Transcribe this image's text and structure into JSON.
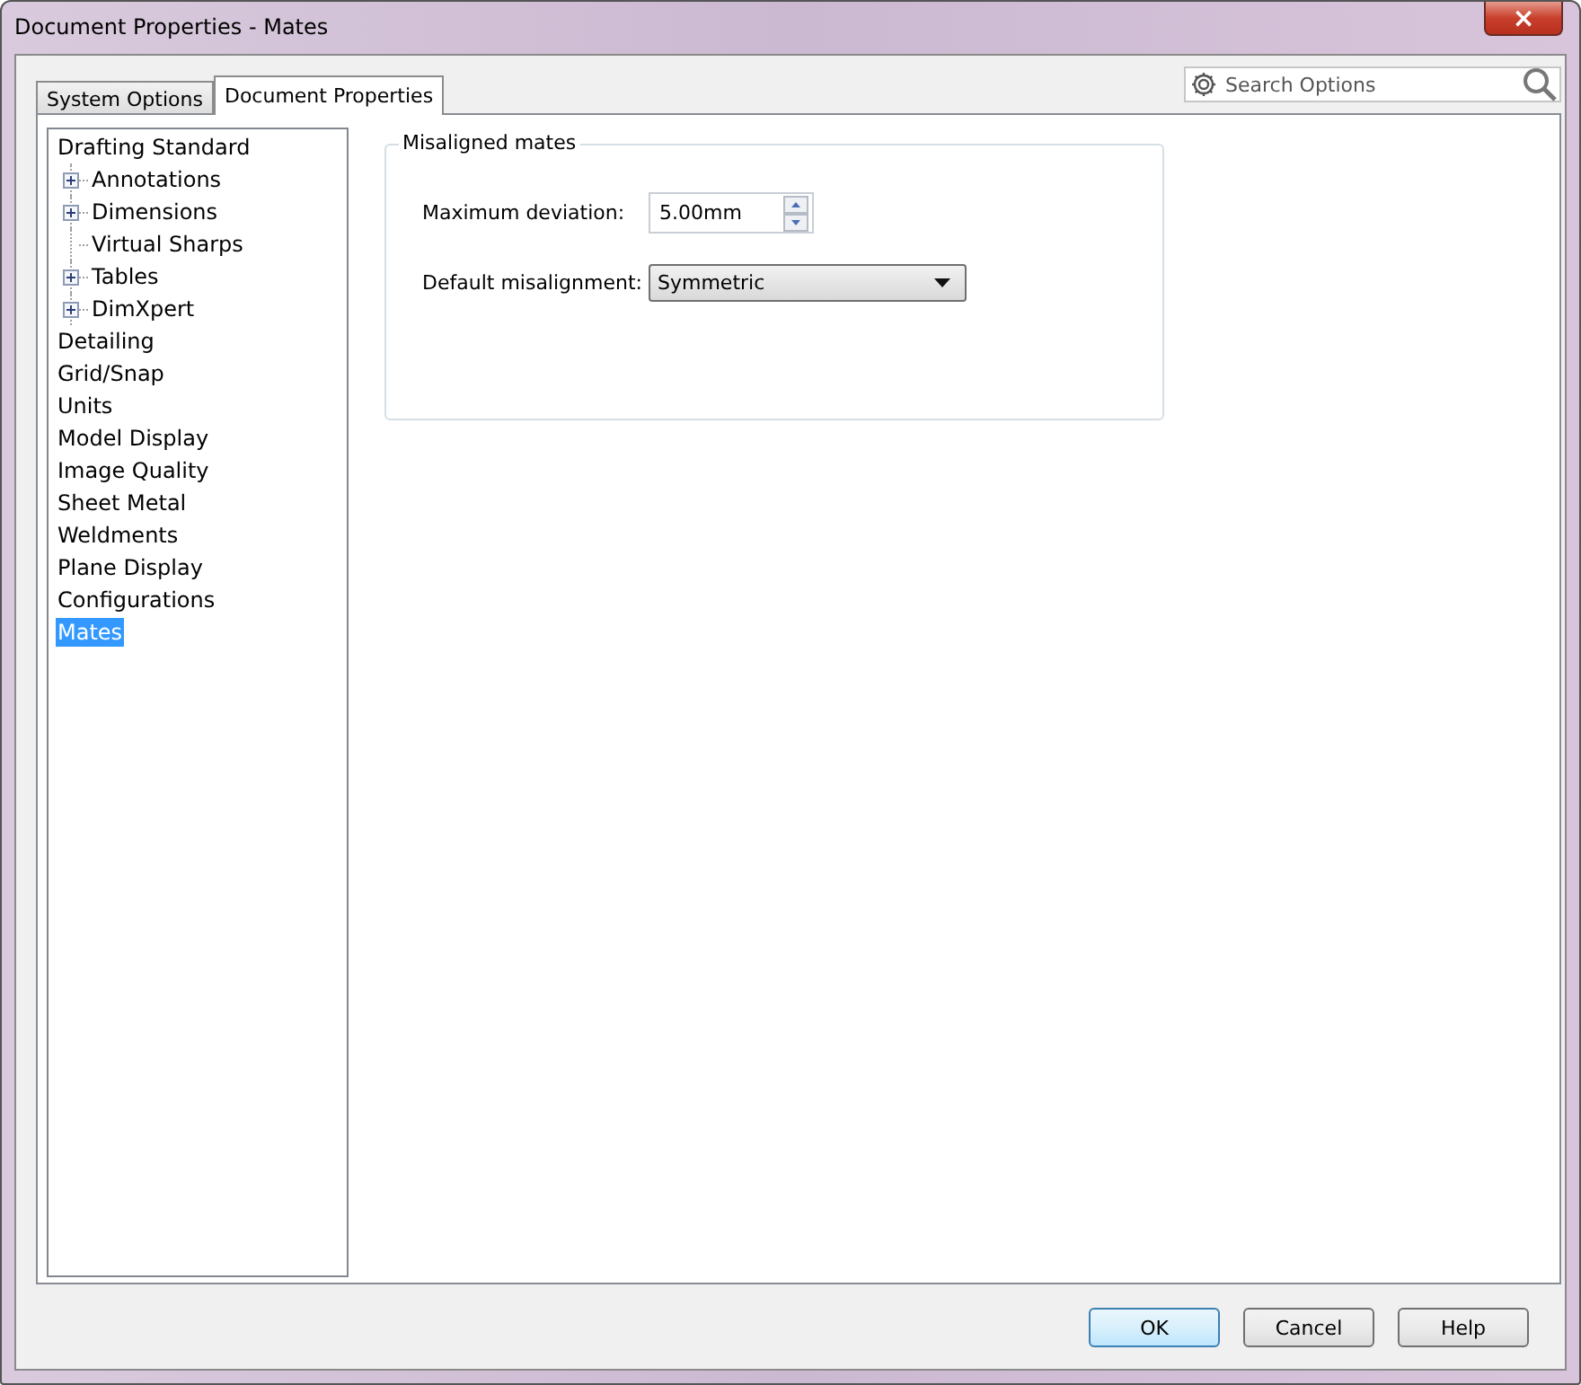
{
  "window": {
    "title": "Document Properties - Mates",
    "close": "×"
  },
  "tabs": [
    {
      "label": "System Options",
      "selected": false
    },
    {
      "label": "Document Properties",
      "selected": true
    }
  ],
  "search": {
    "placeholder": "Search Options"
  },
  "tree": [
    {
      "label": "Drafting Standard",
      "selected": false,
      "children": [
        {
          "label": "Annotations",
          "kind": "collapsed",
          "selected": false
        },
        {
          "label": "Dimensions",
          "kind": "collapsed",
          "selected": false
        },
        {
          "label": "Virtual Sharps",
          "kind": "leaf",
          "selected": false
        },
        {
          "label": "Tables",
          "kind": "collapsed",
          "selected": false
        },
        {
          "label": "DimXpert",
          "kind": "collapsed",
          "selected": false
        }
      ]
    },
    {
      "label": "Detailing",
      "selected": false
    },
    {
      "label": "Grid/Snap",
      "selected": false
    },
    {
      "label": "Units",
      "selected": false
    },
    {
      "label": "Model Display",
      "selected": false
    },
    {
      "label": "Image Quality",
      "selected": false
    },
    {
      "label": "Sheet Metal",
      "selected": false
    },
    {
      "label": "Weldments",
      "selected": false
    },
    {
      "label": "Plane Display",
      "selected": false
    },
    {
      "label": "Configurations",
      "selected": false
    },
    {
      "label": "Mates",
      "selected": true
    }
  ],
  "group": {
    "title": "Misaligned mates",
    "fields": [
      {
        "label": "Maximum deviation:",
        "kind": "spin",
        "value": "5.00mm"
      },
      {
        "label": "Default misalignment:",
        "kind": "dropdown",
        "value": "Symmetric"
      }
    ]
  },
  "buttons": [
    {
      "label": "OK",
      "default": true
    },
    {
      "label": "Cancel",
      "default": false
    },
    {
      "label": "Help",
      "default": false
    }
  ]
}
